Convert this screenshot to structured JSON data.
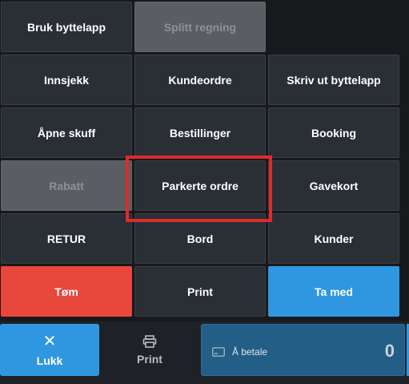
{
  "grid": {
    "row1": {
      "c1": "Bruk byttelapp",
      "c2": "Splitt regning"
    },
    "row2": {
      "c1": "Innsjekk",
      "c2": "Kundeordre",
      "c3": "Skriv ut byttelapp"
    },
    "row3": {
      "c1": "Åpne skuff",
      "c2": "Bestillinger",
      "c3": "Booking"
    },
    "row4": {
      "c1": "Rabatt",
      "c2": "Parkerte ordre",
      "c3": "Gavekort"
    },
    "row5": {
      "c1": "RETUR",
      "c2": "Bord",
      "c3": "Kunder"
    },
    "row6": {
      "c1": "Tøm",
      "c2": "Print",
      "c3": "Ta med"
    }
  },
  "bottom": {
    "close_label": "Lukk",
    "print_label": "Print",
    "pay_label": "Å betale",
    "pay_amount": "0"
  },
  "colors": {
    "background": "#17191d",
    "button": "#2a2e35",
    "disabled": "#5a5e63",
    "danger": "#e8473b",
    "primary": "#2f97e0",
    "pay": "#235e86",
    "highlight": "#e02b2b"
  },
  "icons": {
    "close": "close-icon",
    "print": "printer-icon",
    "pay": "card-icon"
  }
}
